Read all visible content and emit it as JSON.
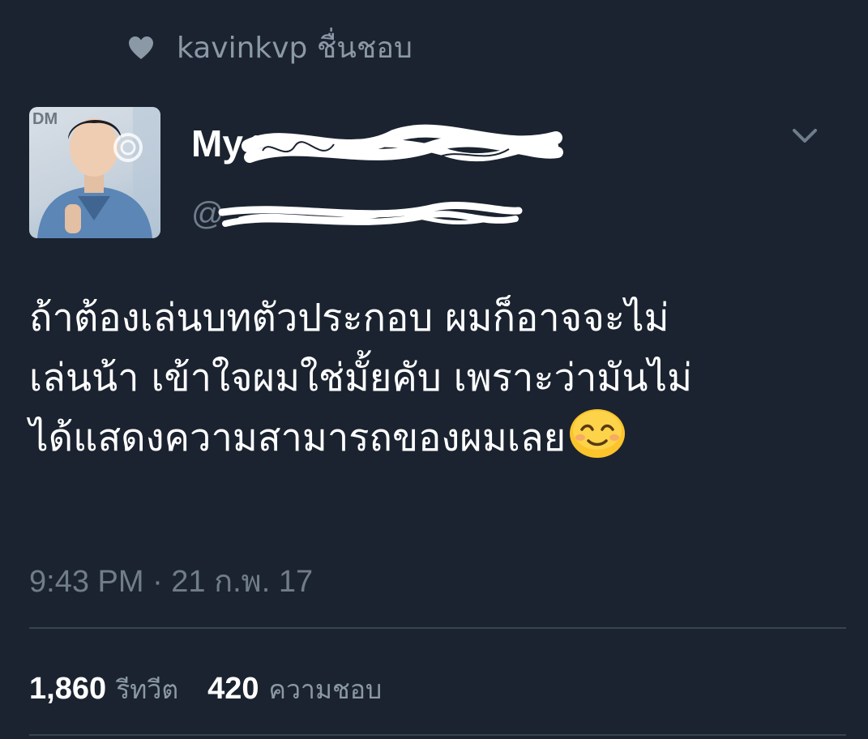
{
  "liked_by": {
    "icon": "heart-icon",
    "text": "kavinkvp ชื่นชอบ"
  },
  "author": {
    "avatar_label": "DM",
    "display_name": "My",
    "handle": "@"
  },
  "tweet": {
    "lines": [
      "ถ้าต้องเล่นบทตัวประกอบ ผมก็อาจจะไม่",
      "เล่นน้า เข้าใจผมใช่มั้ยคับ เพราะว่ามันไม่",
      "ได้แสดงความสามารถของผมเลย"
    ],
    "emoji": "smiling-face-emoji",
    "timestamp": "9:43 PM · 21 ก.พ. 17"
  },
  "stats": {
    "retweets_count": "1,860",
    "retweets_label": "รีทวีต",
    "likes_count": "420",
    "likes_label": "ความชอบ"
  },
  "colors": {
    "background": "#1b2330",
    "text_primary": "#ffffff",
    "text_secondary": "#8b98a5",
    "divider": "#38444d"
  }
}
